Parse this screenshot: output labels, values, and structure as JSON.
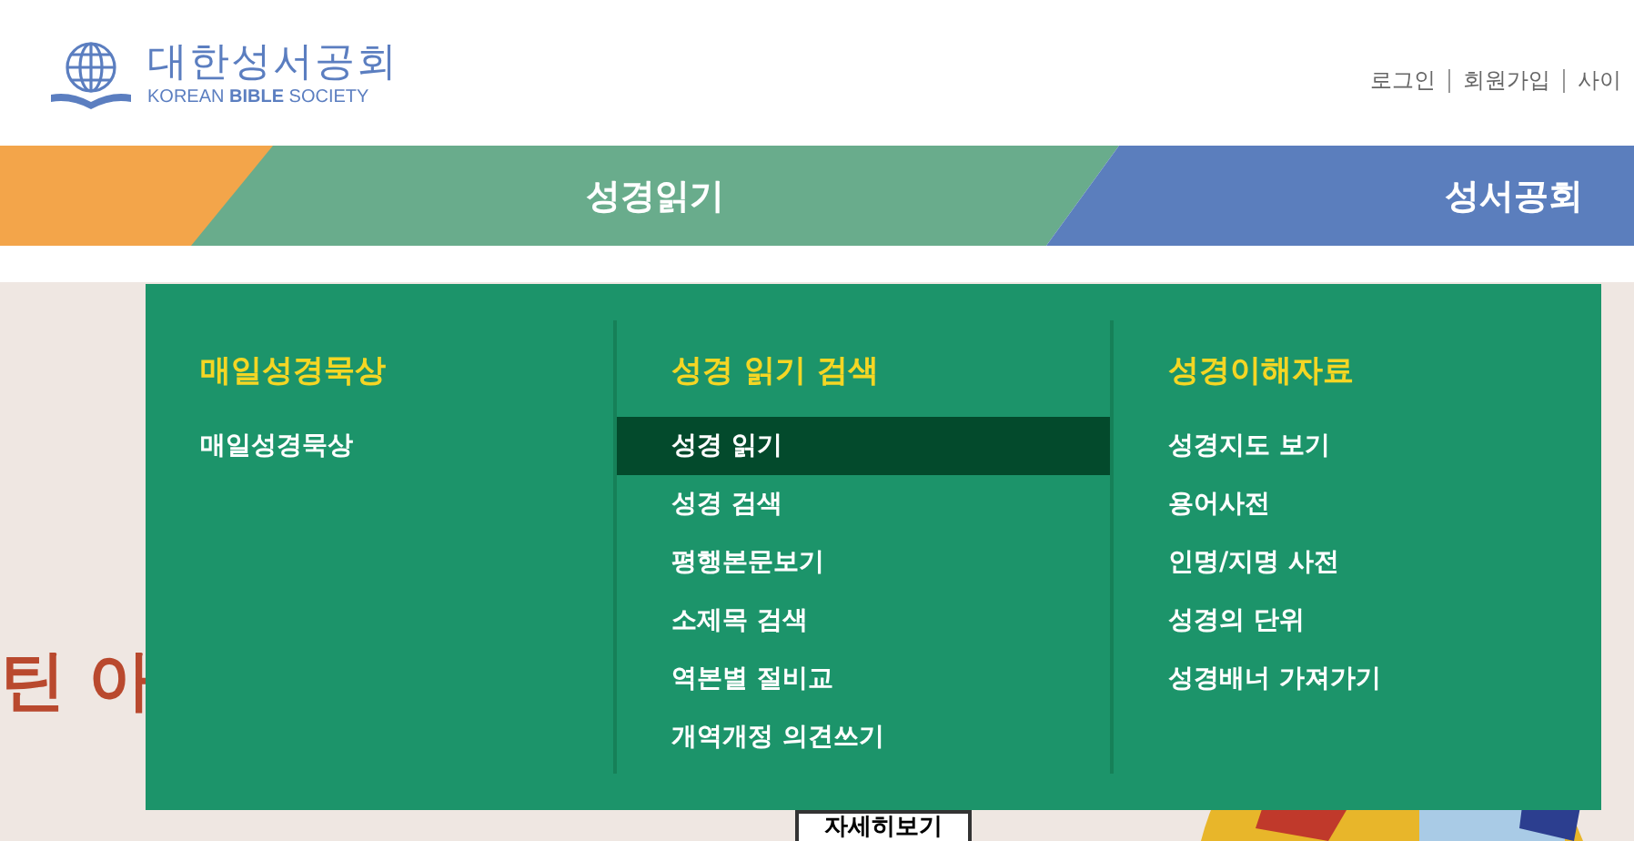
{
  "logo": {
    "title": "대한성서공회",
    "subtitle": "KOREAN **BIBLE** SOCIETY"
  },
  "top_links": [
    "로그인",
    "회원가입",
    "사이"
  ],
  "nav_tabs": [
    {
      "label": "성경읽기"
    },
    {
      "label": "성서공회"
    }
  ],
  "banner": {
    "title": "틴 아",
    "button": "자세히보기"
  },
  "menu": {
    "columns": [
      {
        "heading": "매일성경묵상",
        "items": [
          {
            "label": "매일성경묵상",
            "selected": false
          }
        ]
      },
      {
        "heading": "성경 읽기 검색",
        "items": [
          {
            "label": "성경 읽기",
            "selected": true
          },
          {
            "label": "성경 검색",
            "selected": false
          },
          {
            "label": "평행본문보기",
            "selected": false
          },
          {
            "label": "소제목 검색",
            "selected": false
          },
          {
            "label": "역본별 절비교",
            "selected": false
          },
          {
            "label": "개역개정 의견쓰기",
            "selected": false
          }
        ]
      },
      {
        "heading": "성경이해자료",
        "items": [
          {
            "label": "성경지도 보기",
            "selected": false
          },
          {
            "label": "용어사전",
            "selected": false
          },
          {
            "label": "인명/지명 사전",
            "selected": false
          },
          {
            "label": "성경의 단위",
            "selected": false
          },
          {
            "label": "성경배너 가져가기",
            "selected": false
          }
        ]
      }
    ]
  }
}
